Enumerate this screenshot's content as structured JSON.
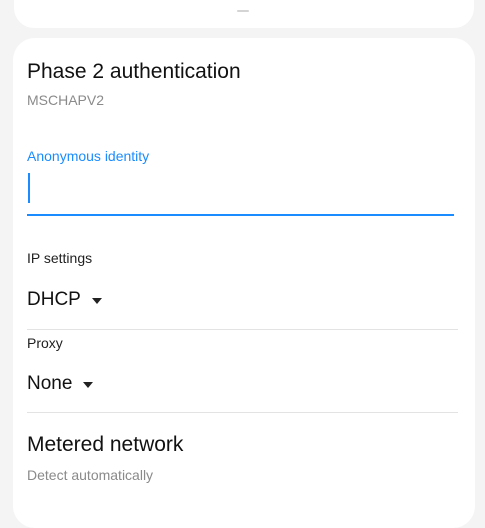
{
  "phase2": {
    "title": "Phase 2 authentication",
    "value": "MSCHAPV2"
  },
  "anonymous_identity": {
    "label": "Anonymous identity",
    "value": ""
  },
  "ip_settings": {
    "label": "IP settings",
    "value": "DHCP"
  },
  "proxy": {
    "label": "Proxy",
    "value": "None"
  },
  "metered": {
    "title": "Metered network",
    "value": "Detect automatically"
  },
  "colors": {
    "accent": "#1a8cff",
    "background": "#f4f4f4",
    "card": "#ffffff",
    "secondary_text": "#8a8a8a"
  },
  "icons": {
    "dropdown": "triangle-down-icon"
  }
}
